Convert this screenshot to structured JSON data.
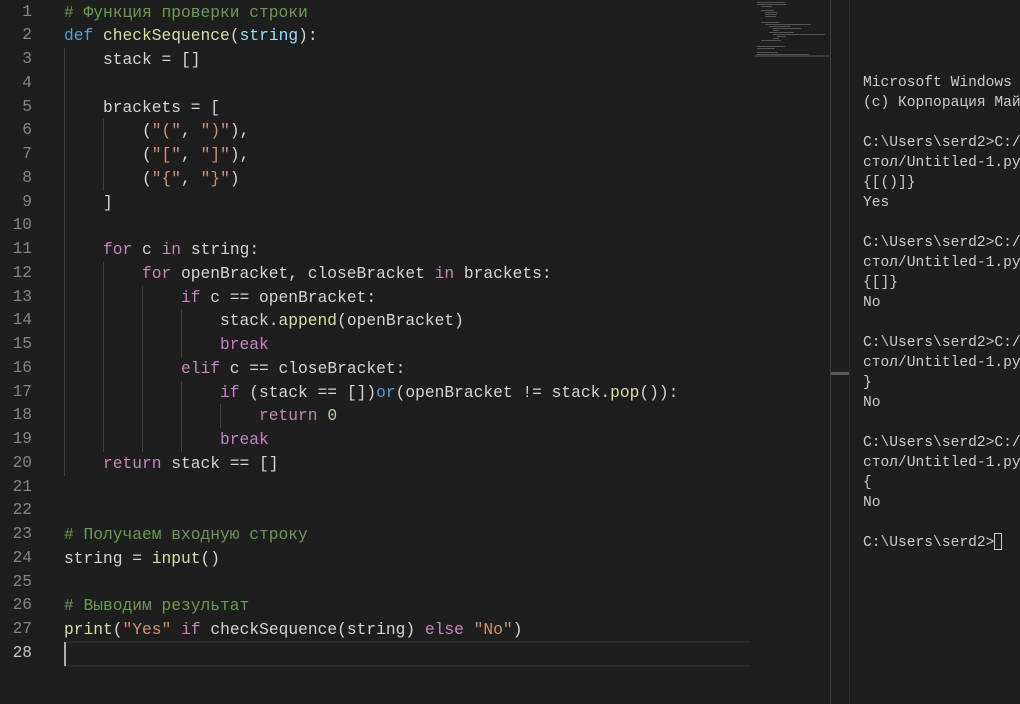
{
  "editor": {
    "active_line": 28,
    "lines": [
      {
        "indent": 0,
        "tokens": [
          [
            "# Функция проверки строки",
            "comment"
          ]
        ]
      },
      {
        "indent": 0,
        "tokens": [
          [
            "def",
            "kw"
          ],
          [
            " ",
            "plain"
          ],
          [
            "checkSequence",
            "fn"
          ],
          [
            "(",
            "plain"
          ],
          [
            "string",
            "param"
          ],
          [
            "):",
            "plain"
          ]
        ]
      },
      {
        "indent": 1,
        "tokens": [
          [
            "stack = []",
            "plain"
          ]
        ]
      },
      {
        "indent": 1,
        "tokens": []
      },
      {
        "indent": 1,
        "tokens": [
          [
            "brackets = [",
            "plain"
          ]
        ]
      },
      {
        "indent": 2,
        "tokens": [
          [
            "(",
            "plain"
          ],
          [
            "\"(\"",
            "str"
          ],
          [
            ", ",
            "plain"
          ],
          [
            "\")\"",
            "str"
          ],
          [
            "),",
            "plain"
          ]
        ]
      },
      {
        "indent": 2,
        "tokens": [
          [
            "(",
            "plain"
          ],
          [
            "\"[\"",
            "str"
          ],
          [
            ", ",
            "plain"
          ],
          [
            "\"]\"",
            "str"
          ],
          [
            "),",
            "plain"
          ]
        ]
      },
      {
        "indent": 2,
        "tokens": [
          [
            "(",
            "plain"
          ],
          [
            "\"{\"",
            "str"
          ],
          [
            ", ",
            "plain"
          ],
          [
            "\"}\"",
            "str"
          ],
          [
            ")",
            "plain"
          ]
        ]
      },
      {
        "indent": 1,
        "tokens": [
          [
            "]",
            "plain"
          ]
        ]
      },
      {
        "indent": 1,
        "tokens": []
      },
      {
        "indent": 1,
        "tokens": [
          [
            "for",
            "ctrl"
          ],
          [
            " c ",
            "plain"
          ],
          [
            "in",
            "ctrl"
          ],
          [
            " string:",
            "plain"
          ]
        ]
      },
      {
        "indent": 2,
        "tokens": [
          [
            "for",
            "ctrl"
          ],
          [
            " openBracket, closeBracket ",
            "plain"
          ],
          [
            "in",
            "ctrl"
          ],
          [
            " brackets:",
            "plain"
          ]
        ]
      },
      {
        "indent": 3,
        "tokens": [
          [
            "if",
            "ctrl"
          ],
          [
            " c == openBracket:",
            "plain"
          ]
        ]
      },
      {
        "indent": 4,
        "tokens": [
          [
            "stack.",
            "plain"
          ],
          [
            "append",
            "fn"
          ],
          [
            "(openBracket)",
            "plain"
          ]
        ]
      },
      {
        "indent": 4,
        "tokens": [
          [
            "break",
            "ctrl"
          ]
        ]
      },
      {
        "indent": 3,
        "tokens": [
          [
            "elif",
            "ctrl"
          ],
          [
            " c == closeBracket:",
            "plain"
          ]
        ]
      },
      {
        "indent": 4,
        "tokens": [
          [
            "if",
            "ctrl"
          ],
          [
            " (stack == [])",
            "plain"
          ],
          [
            "or",
            "kw"
          ],
          [
            "(openBracket != stack.",
            "plain"
          ],
          [
            "pop",
            "fn"
          ],
          [
            "()):",
            "plain"
          ]
        ]
      },
      {
        "indent": 5,
        "tokens": [
          [
            "return",
            "ctrl"
          ],
          [
            " ",
            "plain"
          ],
          [
            "0",
            "num"
          ]
        ]
      },
      {
        "indent": 4,
        "tokens": [
          [
            "break",
            "ctrl"
          ]
        ]
      },
      {
        "indent": 1,
        "tokens": [
          [
            "return",
            "ctrl"
          ],
          [
            " stack == []",
            "plain"
          ]
        ]
      },
      {
        "indent": 0,
        "tokens": []
      },
      {
        "indent": 0,
        "tokens": []
      },
      {
        "indent": 0,
        "tokens": [
          [
            "# Получаем входную строку",
            "comment"
          ]
        ]
      },
      {
        "indent": 0,
        "tokens": [
          [
            "string = ",
            "plain"
          ],
          [
            "input",
            "fn"
          ],
          [
            "()",
            "plain"
          ]
        ]
      },
      {
        "indent": 0,
        "tokens": []
      },
      {
        "indent": 0,
        "tokens": [
          [
            "# Выводим результат",
            "comment"
          ]
        ]
      },
      {
        "indent": 0,
        "tokens": [
          [
            "print",
            "fn"
          ],
          [
            "(",
            "plain"
          ],
          [
            "\"Yes\"",
            "str"
          ],
          [
            " ",
            "plain"
          ],
          [
            "if",
            "ctrl"
          ],
          [
            " ",
            "plain"
          ],
          [
            "checkSequence",
            "plain"
          ],
          [
            "(string) ",
            "plain"
          ],
          [
            "else",
            "ctrl"
          ],
          [
            " ",
            "plain"
          ],
          [
            "\"No\"",
            "str"
          ],
          [
            ")",
            "plain"
          ]
        ]
      },
      {
        "indent": 0,
        "tokens": []
      }
    ]
  },
  "terminal": {
    "lines": [
      "Microsoft Windows",
      "(c) Корпорация Май",
      "",
      "C:\\Users\\serd2>C:/",
      "стол/Untitled-1.py",
      "{[()]}",
      "Yes",
      "",
      "C:\\Users\\serd2>C:/",
      "стол/Untitled-1.py",
      "{[]}",
      "No",
      "",
      "C:\\Users\\serd2>C:/",
      "стол/Untitled-1.py",
      "}",
      "No",
      "",
      "C:\\Users\\serd2>C:/",
      "стол/Untitled-1.py",
      "{",
      "No",
      "",
      "C:\\Users\\serd2>"
    ]
  }
}
